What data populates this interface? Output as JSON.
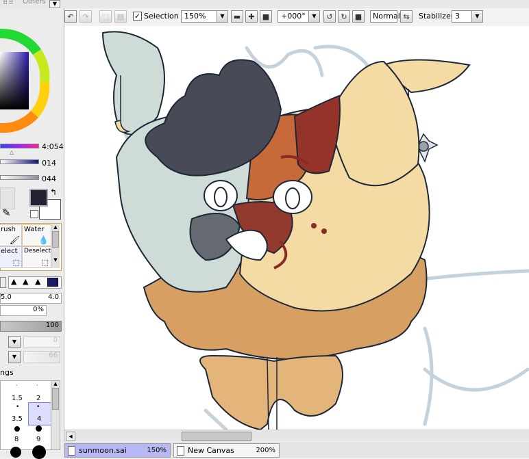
{
  "top_strip": {
    "partial_label": "Others"
  },
  "toolbar": {
    "selection_label": "Selection",
    "selection_checked": true,
    "zoom": "150%",
    "rotation": "+000°",
    "blend_mode": "Normal",
    "stabilizer_label": "Stabilizer",
    "stabilizer_value": "3"
  },
  "left_panel": {
    "slider_values": [
      "4:054",
      "014",
      "044"
    ],
    "tools": [
      {
        "label": "rush"
      },
      {
        "label": "Water"
      },
      {
        "label": "elect"
      },
      {
        "label": "Deselect"
      }
    ],
    "density_values": [
      "5.0",
      "4.0"
    ],
    "percent": "0%",
    "opacity": "100",
    "field_a": "0",
    "field_b": "66",
    "settings_label": "ngs",
    "brush_sizes": [
      "1.5",
      "2",
      "3.5",
      "4",
      "8",
      "9"
    ]
  },
  "tabs": [
    {
      "name": "sunmoon.sai",
      "zoom": "150%"
    },
    {
      "name": "New Canvas",
      "zoom": "200%"
    }
  ],
  "colors": {
    "primary": "#232232",
    "secondary": "#ffffff",
    "tab_active": "#b8b8f4"
  }
}
